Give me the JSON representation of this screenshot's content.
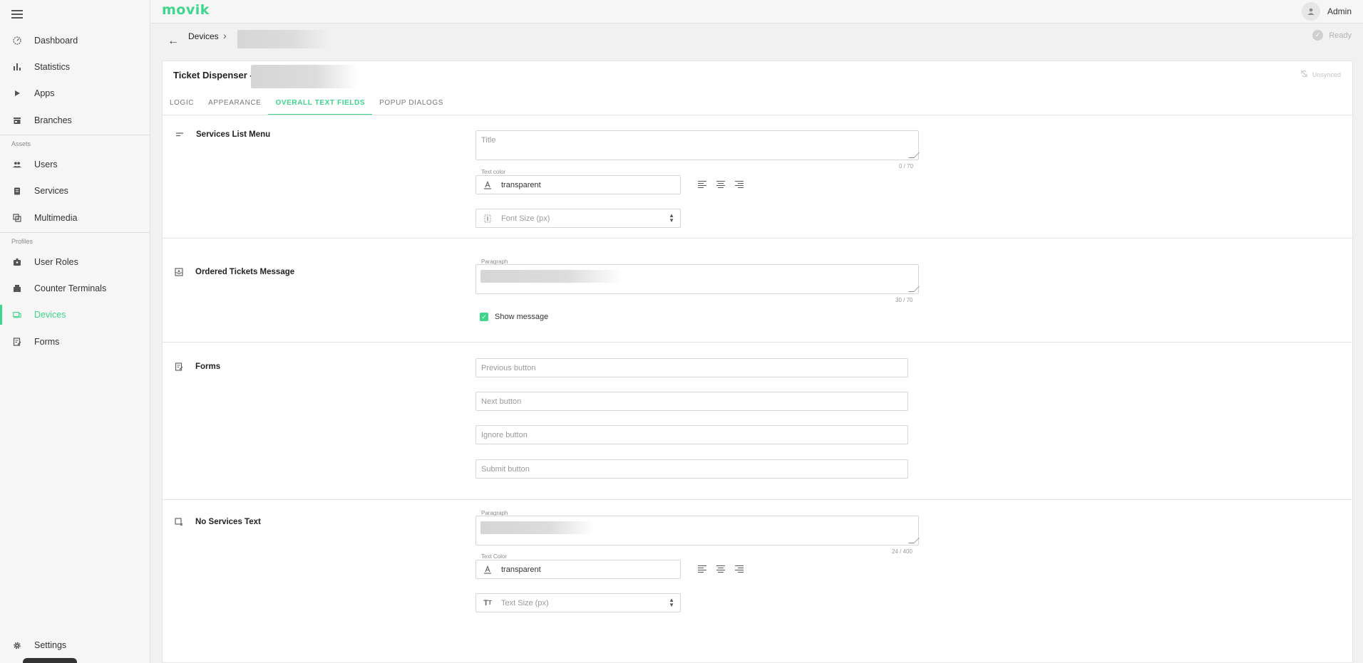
{
  "brand": {
    "logo": "movik",
    "accent": "#3dd68c"
  },
  "user": {
    "name": "Admin"
  },
  "status": {
    "ready": "Ready",
    "sync": "Unsynced"
  },
  "sidebar": {
    "items": [
      {
        "label": "Dashboard",
        "icon": "dashboard-icon"
      },
      {
        "label": "Statistics",
        "icon": "bar-chart-icon"
      },
      {
        "label": "Apps",
        "icon": "play-icon"
      },
      {
        "label": "Branches",
        "icon": "store-icon"
      }
    ],
    "assets_label": "Assets",
    "assets": [
      {
        "label": "Users",
        "icon": "people-icon"
      },
      {
        "label": "Services",
        "icon": "clipboard-icon"
      },
      {
        "label": "Multimedia",
        "icon": "media-icon"
      }
    ],
    "profiles_label": "Profiles",
    "profiles": [
      {
        "label": "User Roles",
        "icon": "user-badge-icon"
      },
      {
        "label": "Counter Terminals",
        "icon": "terminal-icon"
      },
      {
        "label": "Devices",
        "icon": "devices-icon",
        "active": true
      },
      {
        "label": "Forms",
        "icon": "form-icon"
      }
    ],
    "settings": "Settings"
  },
  "breadcrumb": {
    "parent": "Devices"
  },
  "card": {
    "title": "Ticket Dispenser -",
    "tabs": [
      "LOGIC",
      "APPEARANCE",
      "OVERALL TEXT FIELDS",
      "POPUP DIALOGS"
    ],
    "active_tab": "OVERALL TEXT FIELDS"
  },
  "sections": {
    "services_list": {
      "title": "Services List Menu",
      "title_placeholder": "Title",
      "title_counter": "0 / 70",
      "text_color_label": "Text color",
      "text_color_value": "transparent",
      "font_size_placeholder": "Font Size (px)"
    },
    "ordered_tickets": {
      "title": "Ordered Tickets Message",
      "paragraph_label": "Paragraph",
      "counter": "30 / 70",
      "show_message": "Show message"
    },
    "forms": {
      "title": "Forms",
      "previous": "Previous button",
      "next": "Next button",
      "ignore": "Ignore button",
      "submit": "Submit button"
    },
    "no_services": {
      "title": "No Services Text",
      "paragraph_label": "Paragraph",
      "counter": "24 / 400",
      "text_color_label": "Text Color",
      "text_color_value": "transparent",
      "text_size_placeholder": "Text Size (px)"
    }
  }
}
